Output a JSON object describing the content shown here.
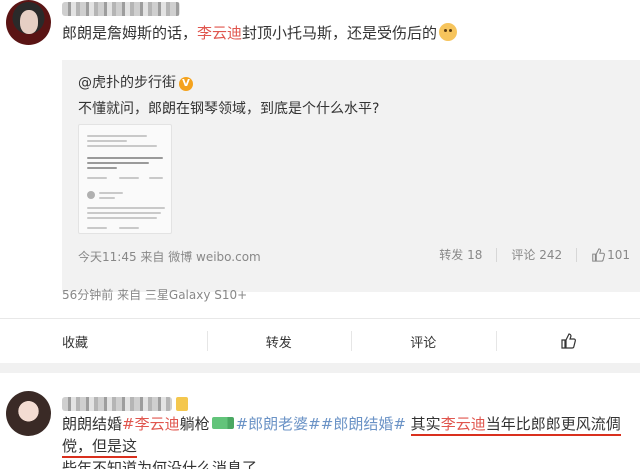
{
  "post1": {
    "text_prefix": "郎朗是詹姆斯的话，",
    "text_highlight": "李云迪",
    "text_suffix": "封顶小托马斯，还是受伤后的",
    "emoji": "cat-emoji",
    "repost": {
      "user": "@虎扑的步行街",
      "badge": "V",
      "text": "不懂就问，郎朗在钢琴领域，到底是个什么水平?",
      "meta": "今天11:45 来自 微博 weibo.com",
      "repost_label": "转发",
      "repost_count": "18",
      "comment_label": "评论",
      "comment_count": "242",
      "like_count": "101"
    },
    "meta": "56分钟前 来自 三星Galaxy S10+",
    "actions": {
      "favorite": "收藏",
      "repost": "转发",
      "comment": "评论"
    }
  },
  "post2": {
    "part1": "朗朗结婚",
    "tag1": "#李云迪",
    "part2": "躺枪",
    "tags": "#郎朗老婆##郎朗结婚#",
    "part3_a": "其实",
    "part3_b": "李云迪",
    "part3_c": "当年比郎郎更风流倜傥，但是这",
    "line2": "些年不知道为何没什么消息了"
  },
  "colors": {
    "highlight_red": "#e0564e",
    "tag_blue": "#6b93c6",
    "underline_red": "#d9301e"
  }
}
